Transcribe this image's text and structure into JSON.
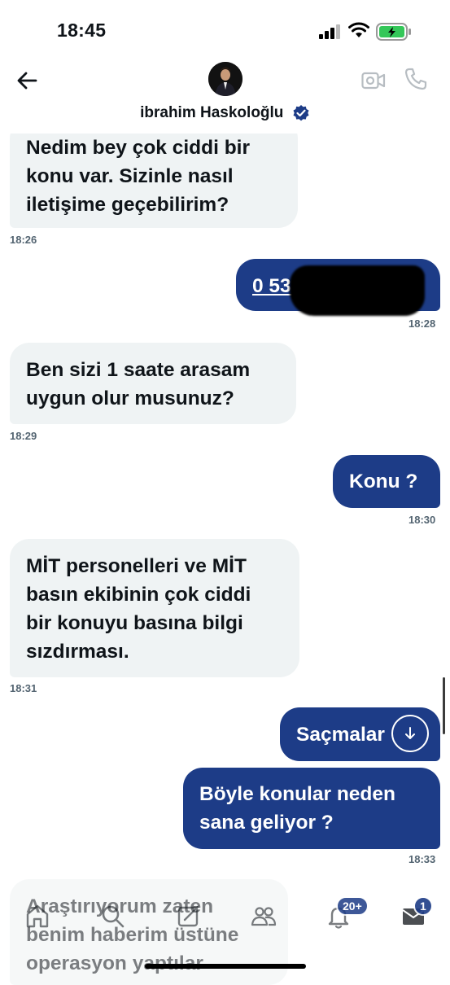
{
  "status_bar": {
    "time": "18:45",
    "icons": [
      "signal-icon",
      "wifi-icon",
      "battery-charging-icon"
    ]
  },
  "header": {
    "contact_name": "ibrahim Haskoloğlu",
    "icons": [
      "back-arrow-icon",
      "verified-badge-icon",
      "video-call-icon",
      "phone-call-icon"
    ]
  },
  "messages": [
    {
      "direction": "in",
      "text_lines": [
        "Nedim bey çok ciddi bir",
        "konu var. Sizinle nasıl",
        "iletişime geçebilirim?"
      ],
      "time": "18:26"
    },
    {
      "direction": "out",
      "text": "0 535",
      "redacted": true,
      "time": "18:28"
    },
    {
      "direction": "in",
      "text_lines": [
        "Ben sizi 1 saate arasam",
        "uygun olur musunuz?"
      ],
      "time": "18:29"
    },
    {
      "direction": "out",
      "text_lines": [
        "Konu ?"
      ],
      "time": "18:30"
    },
    {
      "direction": "in",
      "text_lines": [
        "MİT personelleri ve MİT",
        "basın ekibinin çok ciddi",
        "bir konuyu basına bilgi",
        "sızdırması."
      ],
      "time": "18:31"
    },
    {
      "direction": "out",
      "text_lines": [
        "Saçmalar"
      ],
      "time": ""
    },
    {
      "direction": "out",
      "text_lines": [
        "Böyle konular neden",
        "sana geliyor ?"
      ],
      "time": "18:33"
    },
    {
      "direction": "in",
      "text_lines": [
        "Araştırıyorum zaten",
        "benim haberim üstüne",
        "operasyon yaptılar"
      ],
      "time": ""
    }
  ],
  "tab_bar": {
    "tabs": [
      "home-icon",
      "search-icon",
      "compose-icon",
      "communities-icon",
      "notifications-icon",
      "messages-icon"
    ],
    "notifications_badge": "20+",
    "messages_badge": "1"
  },
  "colors": {
    "outgoing_bubble": "#1d3c87",
    "incoming_bubble": "#eff3f4",
    "timestamp": "#536471"
  }
}
